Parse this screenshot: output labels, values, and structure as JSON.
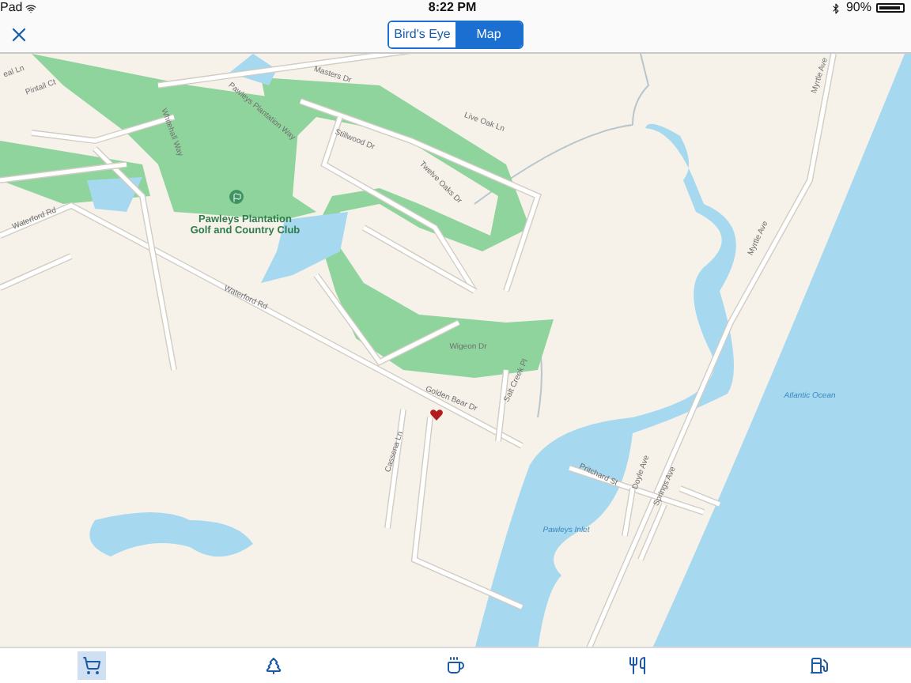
{
  "status_bar": {
    "carrier": "Pad",
    "time": "8:22 PM",
    "battery": "90%"
  },
  "nav": {
    "segments": [
      {
        "label": "Bird's Eye",
        "selected": false
      },
      {
        "label": "Map",
        "selected": true
      }
    ]
  },
  "map": {
    "labels": [
      {
        "text": "eal Ln",
        "kind": "street"
      },
      {
        "text": "Pintail Ct",
        "kind": "street"
      },
      {
        "text": "Waterford Rd",
        "kind": "street"
      },
      {
        "text": "Whitehall Way",
        "kind": "street"
      },
      {
        "text": "Pawleys Plantation Way",
        "kind": "street"
      },
      {
        "text": "Masters Dr",
        "kind": "street"
      },
      {
        "text": "Stillwood Dr",
        "kind": "street"
      },
      {
        "text": "Live Oak Ln",
        "kind": "street"
      },
      {
        "text": "Twelve Oaks Dr",
        "kind": "street"
      },
      {
        "text": "Pawleys Plantation Golf and Country Club",
        "kind": "poi"
      },
      {
        "text": "Waterford Rd",
        "kind": "street"
      },
      {
        "text": "Wigeon Dr",
        "kind": "street"
      },
      {
        "text": "Golden Bear Dr",
        "kind": "street"
      },
      {
        "text": "Salt Creek Pl",
        "kind": "street"
      },
      {
        "text": "Cassena Ln",
        "kind": "street"
      },
      {
        "text": "Pritchard St",
        "kind": "street"
      },
      {
        "text": "Doyle Ave",
        "kind": "street"
      },
      {
        "text": "Springs Ave",
        "kind": "street"
      },
      {
        "text": "Myrtle Ave",
        "kind": "street"
      },
      {
        "text": "Myrtle Ave",
        "kind": "street"
      },
      {
        "text": "Atlantic Ocean",
        "kind": "water"
      },
      {
        "text": "Pawleys Inlet",
        "kind": "water"
      }
    ]
  },
  "tab_bar": {
    "tabs": [
      {
        "kind": "shopping",
        "selected": true
      },
      {
        "kind": "parks",
        "selected": false
      },
      {
        "kind": "coffee",
        "selected": false
      },
      {
        "kind": "dining",
        "selected": false
      },
      {
        "kind": "fuel",
        "selected": false
      }
    ]
  }
}
